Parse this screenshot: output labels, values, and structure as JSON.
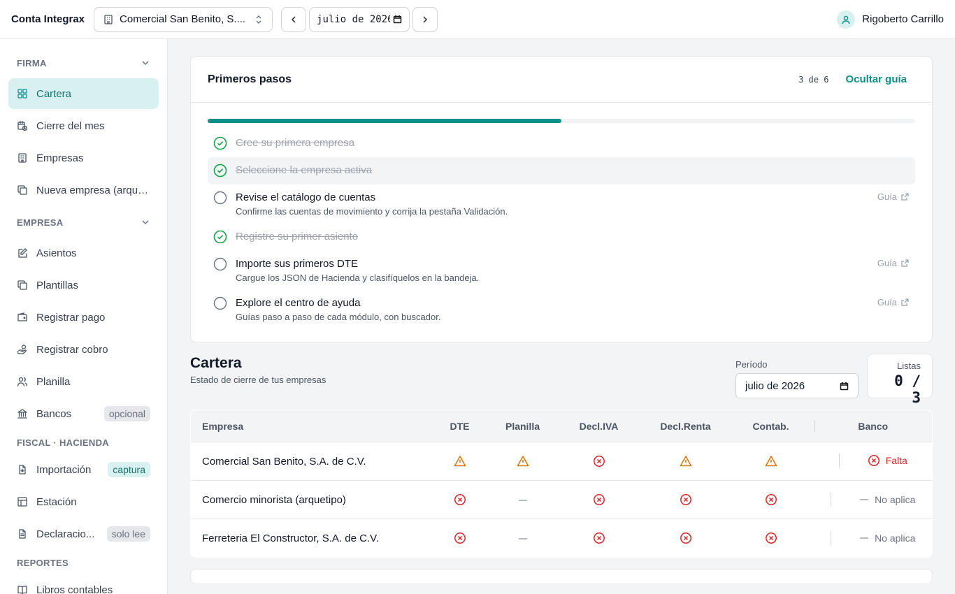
{
  "app": {
    "brand": "Conta Integrax"
  },
  "topbar": {
    "company": "Comercial San Benito, S....",
    "month": "julio de 2026",
    "user": "Rigoberto Carrillo"
  },
  "sidebar": {
    "sections": [
      {
        "title": "FIRMA",
        "items": [
          {
            "label": "Cartera",
            "icon": "grid-icon",
            "active": true
          },
          {
            "label": "Cierre del mes",
            "icon": "calendar-clock-icon"
          },
          {
            "label": "Empresas",
            "icon": "building-icon"
          },
          {
            "label": "Nueva empresa (arque...",
            "icon": "copy-icon"
          }
        ]
      },
      {
        "title": "EMPRESA",
        "items": [
          {
            "label": "Asientos",
            "icon": "edit-icon"
          },
          {
            "label": "Plantillas",
            "icon": "copy-icon"
          },
          {
            "label": "Registrar pago",
            "icon": "wallet-icon"
          },
          {
            "label": "Registrar cobro",
            "icon": "hand-coins-icon"
          },
          {
            "label": "Planilla",
            "icon": "users-icon"
          },
          {
            "label": "Bancos",
            "icon": "bank-icon",
            "badge": "opcional"
          }
        ]
      },
      {
        "title": "FISCAL · HACIENDA",
        "items": [
          {
            "label": "Importación",
            "icon": "file-import-icon",
            "badge": "captura",
            "badge_style": "teal"
          },
          {
            "label": "Estación",
            "icon": "table-icon"
          },
          {
            "label": "Declaracio...",
            "icon": "file-text-icon",
            "badge": "solo lee"
          }
        ]
      },
      {
        "title": "REPORTES",
        "items": [
          {
            "label": "Libros contables",
            "icon": "book-icon"
          }
        ]
      }
    ]
  },
  "guide": {
    "title": "Primeros pasos",
    "count": "3 de 6",
    "progress": 0.5,
    "hide_label": "Ocultar guía",
    "steps": [
      {
        "title": "Cree su primera empresa",
        "done": true
      },
      {
        "title": "Seleccione la empresa activa",
        "done": true,
        "highlight": true
      },
      {
        "title": "Revise el catálogo de cuentas",
        "done": false,
        "desc": "Confirme las cuentas de movimiento y corrija la pestaña Validación.",
        "link": "Guía"
      },
      {
        "title": "Registre su primer asiento",
        "done": true
      },
      {
        "title": "Importe sus primeros DTE",
        "done": false,
        "desc": "Cargue los JSON de Hacienda y clasifíquelos en la bandeja.",
        "link": "Guía"
      },
      {
        "title": "Explore el centro de ayuda",
        "done": false,
        "desc": "Guías paso a paso de cada módulo, con buscador.",
        "link": "Guía"
      }
    ]
  },
  "cartera": {
    "title": "Cartera",
    "subtitle": "Estado de cierre de tus empresas",
    "periodo_label": "Período",
    "periodo_value": "julio de 2026",
    "listas_label": "Listas",
    "listas_value": "0 / 3",
    "columns": [
      "Empresa",
      "DTE",
      "Planilla",
      "Decl.IVA",
      "Decl.Renta",
      "Contab.",
      "Banco"
    ],
    "rows": [
      {
        "empresa": "Comercial San Benito, S.A. de C.V.",
        "status": [
          "warn",
          "warn",
          "error",
          "warn",
          "warn"
        ],
        "banco": {
          "state": "error",
          "label": "Falta"
        }
      },
      {
        "empresa": "Comercio minorista (arquetipo)",
        "status": [
          "error",
          "na",
          "error",
          "error",
          "error"
        ],
        "banco": {
          "state": "na",
          "label": "No aplica"
        }
      },
      {
        "empresa": "Ferreteria El Constructor, S.A. de C.V.",
        "status": [
          "error",
          "na",
          "error",
          "error",
          "error"
        ],
        "banco": {
          "state": "na",
          "label": "No aplica"
        }
      }
    ]
  },
  "colors": {
    "accent": "#0f8f8a",
    "warn": "#d97706",
    "error": "#dc2626",
    "done": "#16a34a"
  }
}
